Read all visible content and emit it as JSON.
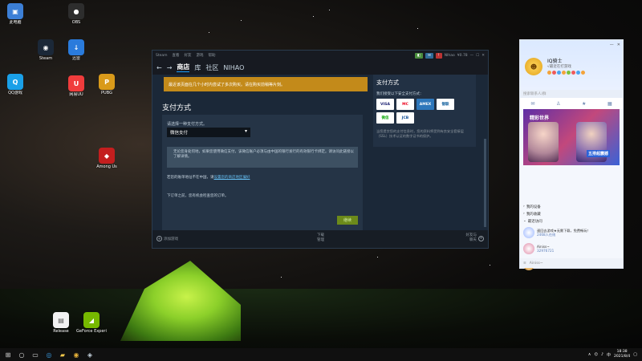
{
  "desktop": {
    "icons": [
      {
        "label": "此电脑",
        "color": "#3c7fd6",
        "glyph": "▣"
      },
      {
        "label": "Steam",
        "color": "#1b2838",
        "glyph": "◉"
      },
      {
        "label": "QQ游戏",
        "color": "#1aa0e8",
        "glyph": "Q"
      },
      {
        "label": "迅雷",
        "color": "#2a7bdc",
        "glyph": "↓"
      },
      {
        "label": "网易UU",
        "color": "#f03c3c",
        "glyph": "U"
      },
      {
        "label": "OBS",
        "color": "#2d2d2d",
        "glyph": "●"
      },
      {
        "label": "PUBG",
        "color": "#d99a1a",
        "glyph": "P"
      },
      {
        "label": "Among Us",
        "color": "#c41e1e",
        "glyph": "◆"
      },
      {
        "label": "Release",
        "color": "#f2f2f2",
        "glyph": "▤"
      },
      {
        "label": "GeForce Experience",
        "color": "#76b900",
        "glyph": "◢"
      }
    ]
  },
  "steam": {
    "titlebar": {
      "menu": [
        "Steam",
        "查看",
        "好友",
        "游戏",
        "帮助"
      ],
      "user": "NIhao",
      "balance": "¥0.78"
    },
    "nav": {
      "store": "商店",
      "library": "库",
      "community": "社区",
      "username": "NIHAO"
    },
    "warning": "最近该页面在几个小时内尝试了多次购买。请在购买前稍等片刻。",
    "page_title": "支付方式",
    "form": {
      "select_label": "请选择一种支付方式。",
      "selected_method": "微信支付",
      "info_text": "无论您身处何地，如果您使用微信支付，该微信账户必须与由中国的银行发行的有效银行卡绑定。请访问此链接以了解详情。",
      "info_link": "链接",
      "country_note": "若您的账单地址不在中国，请",
      "country_link": "设置您的商店地区偏好",
      "confirm_note": "下订单之前，您有机会检查您的订单。",
      "continue_label": "继续"
    },
    "side": {
      "title": "支付方式",
      "subtitle": "我们接受以下安全支付方式：",
      "cards": [
        "VISA",
        "MC",
        "AMEX",
        "银联",
        "微信",
        "JCB"
      ],
      "desc": "当您提交您的支付信息时，您的资料将受到有良安全套接层（SSL）技术认证的数字证书的保护。"
    },
    "footer": {
      "add_game": "添加游戏",
      "downloads": "下载",
      "downloads_sub": "管理",
      "friends": "好友与",
      "friends_sub": "聊天"
    }
  },
  "qq": {
    "nick": "IQ骑士",
    "sign": "√最近在打游戏",
    "search": "搜索联系人/群",
    "banner": {
      "title": "精彩世界",
      "tag": "五排超震撼"
    },
    "groups": [
      "我的设备",
      "我的收藏",
      "最近访问"
    ],
    "contacts": [
      {
        "name": "速回去游戏★无需下载，免费畅玩！",
        "sub": "2468人在线"
      },
      {
        "name": "Ainiss~",
        "sub": "32976721"
      },
      {
        "name": "紧急备战，重燃游戏下的木了",
        "sub": "85600435"
      }
    ],
    "bottom": "Ainiss~"
  },
  "taskbar": {
    "time": "18:38",
    "date": "2021/8/4",
    "lang": "中"
  }
}
